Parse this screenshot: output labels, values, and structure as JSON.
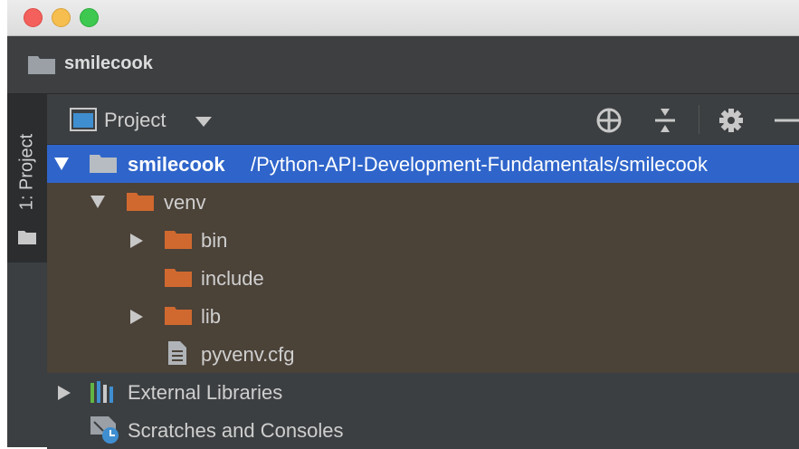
{
  "window": {
    "traffic_lights": {
      "close": {
        "color": "#f4615c"
      },
      "minimize": {
        "color": "#f6be4f"
      },
      "maximize": {
        "color": "#3ec84f"
      }
    }
  },
  "navbar": {
    "title": "smilecook",
    "icon": "folder-icon"
  },
  "side_strip": {
    "tab_label": "1: Project",
    "icon": "folder-icon"
  },
  "toolbar": {
    "view_label": "Project",
    "view_icon": "project-view-icon",
    "dropdown_icon": "caret-down-icon",
    "actions": [
      "locate-target-icon",
      "collapse-all-icon",
      "gear-icon",
      "hide-minus-icon"
    ]
  },
  "tree": {
    "root": {
      "name": "smilecook",
      "path": "/Python-API-Development-Fundamentals/smilecook",
      "expanded": true
    },
    "venv": {
      "name": "venv",
      "expanded": true
    },
    "bin": {
      "name": "bin",
      "expanded": false
    },
    "include": {
      "name": "include"
    },
    "lib": {
      "name": "lib",
      "expanded": false
    },
    "cfg": {
      "name": "pyvenv.cfg",
      "icon": "text-file-icon"
    },
    "external_libraries": {
      "name": "External Libraries",
      "icon": "library-icon"
    },
    "scratches": {
      "name": "Scratches and Consoles",
      "icon": "scratches-icon"
    }
  },
  "colors": {
    "selection": "#2f65ca",
    "excluded_folder_bg": "#4b4238",
    "excluded_folder": "#d0692f",
    "panel_bg": "#3c3f41"
  }
}
